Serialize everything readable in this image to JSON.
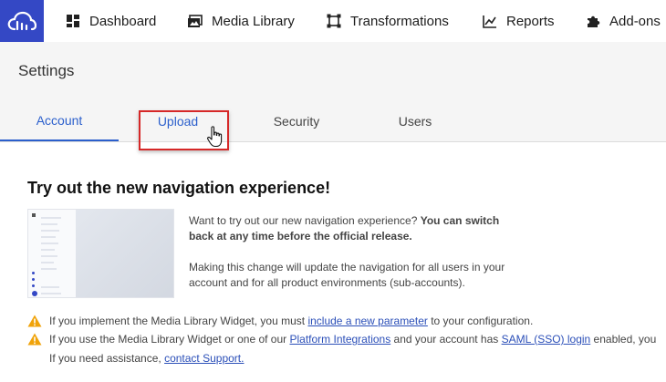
{
  "nav": {
    "items": [
      {
        "label": "Dashboard",
        "icon": "dashboard-icon"
      },
      {
        "label": "Media Library",
        "icon": "media-library-icon"
      },
      {
        "label": "Transformations",
        "icon": "transformations-icon"
      },
      {
        "label": "Reports",
        "icon": "reports-icon"
      },
      {
        "label": "Add-ons",
        "icon": "puzzle-icon"
      }
    ]
  },
  "settings": {
    "title": "Settings"
  },
  "tabs": [
    {
      "label": "Account",
      "state": "active"
    },
    {
      "label": "Upload",
      "state": "hover"
    },
    {
      "label": "Security",
      "state": "default"
    },
    {
      "label": "Users",
      "state": "default"
    }
  ],
  "content": {
    "heading": "Try out the new navigation experience!",
    "para1_normal": "Want to try out our new navigation experience? ",
    "para1_bold": "You can switch back at any time before the official release.",
    "para2": "Making this change will update the navigation for all users in your account and for all product environments (sub-accounts).",
    "warnings": [
      {
        "pre": "If you implement the Media Library Widget, you must ",
        "link": "include a new parameter",
        "post": " to your configuration."
      },
      {
        "pre": "If you use the Media Library Widget or one of our ",
        "link": "Platform Integrations",
        "mid": " and your account has ",
        "link2": "SAML (SSO) login",
        "post": " enabled, you"
      }
    ],
    "assist_pre": "If you need assistance, ",
    "assist_link": "contact Support."
  },
  "colors": {
    "brand": "#3448c5",
    "active_tab": "#2b5fcc",
    "highlight": "#d62828",
    "warning": "#f0a30a"
  }
}
